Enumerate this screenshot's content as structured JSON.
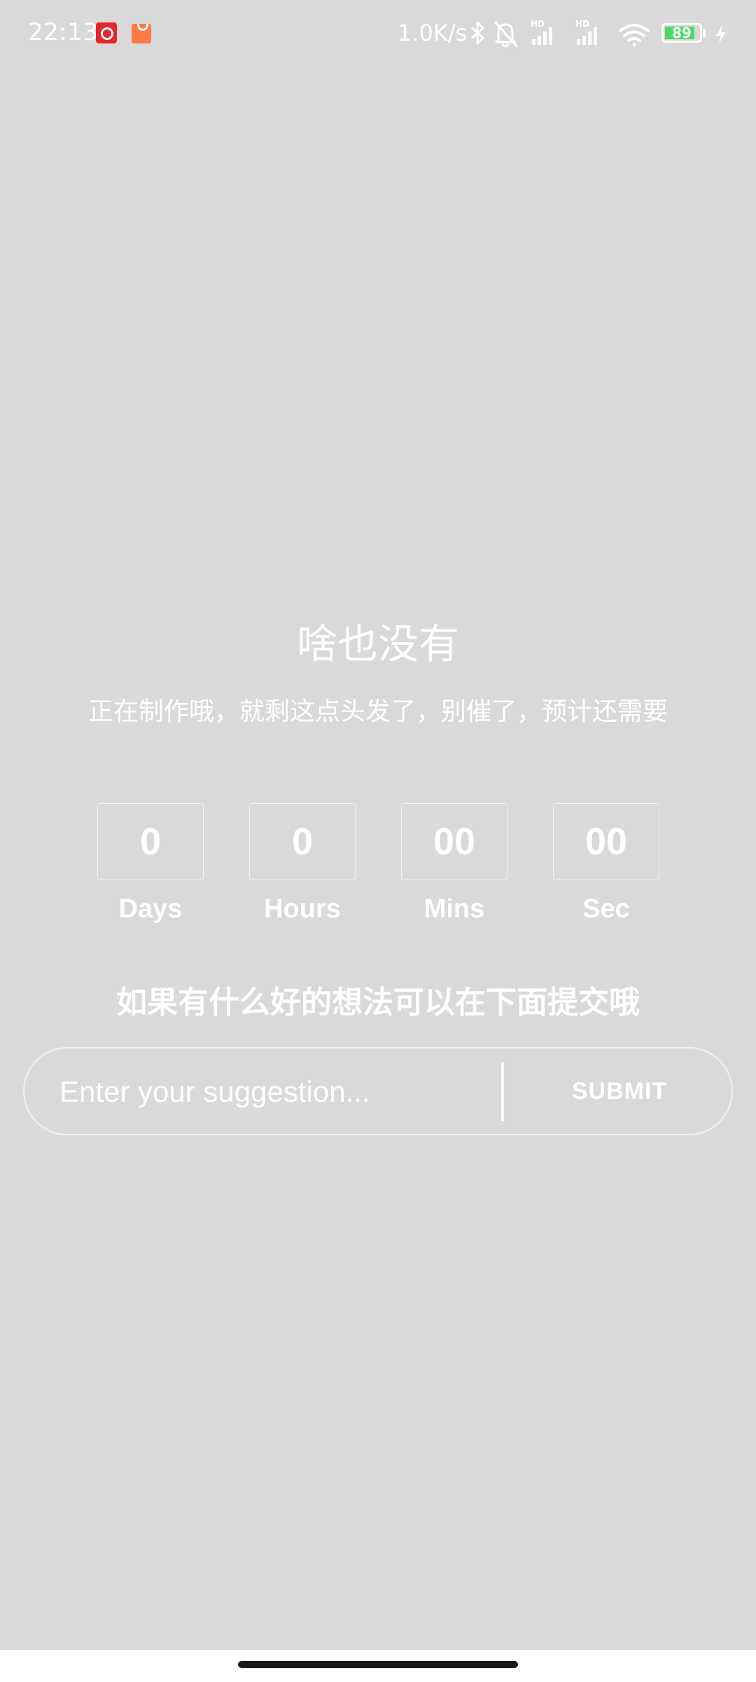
{
  "status_bar": {
    "time": "22:13",
    "net_speed": "1.0K/s",
    "battery_level": "89",
    "battery_fraction": 0.89,
    "battery_color": "#4cd964",
    "icons": [
      "netease-music-icon",
      "shopping-bag-icon",
      "bluetooth-icon",
      "mute-bell-icon",
      "signal-hd-icon",
      "signal-hd-icon",
      "wifi-icon",
      "battery-icon",
      "charging-icon"
    ]
  },
  "main": {
    "title": "啥也没有",
    "subtitle": "正在制作哦，就剩这点头发了，别催了，预计还需要",
    "countdown": [
      {
        "value": "0",
        "label": "Days"
      },
      {
        "value": "0",
        "label": "Hours"
      },
      {
        "value": "00",
        "label": "Mins"
      },
      {
        "value": "00",
        "label": "Sec"
      }
    ],
    "prompt": "如果有什么好的想法可以在下面提交哦",
    "form": {
      "placeholder": "Enter your suggestion...",
      "submit_label": "SUBMIT"
    }
  },
  "colors": {
    "background": "#d9d9d9",
    "text": "#ffffff"
  }
}
